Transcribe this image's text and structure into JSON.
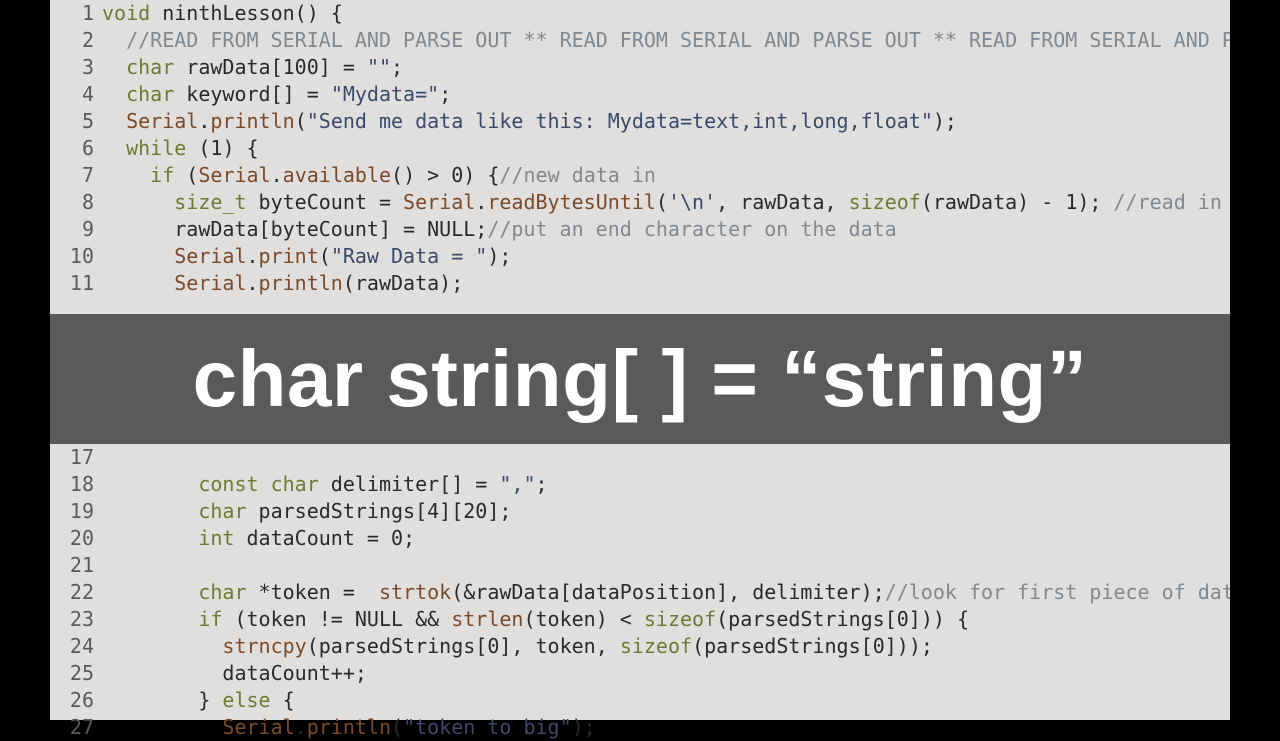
{
  "overlay_text": "char string[ ] = “string”",
  "lines": [
    {
      "n": "1",
      "html": "<span class='kw'>void</span> ninthLesson() {"
    },
    {
      "n": "2",
      "html": "  <span class='cmt'>//READ FROM SERIAL AND PARSE OUT ** READ FROM SERIAL AND PARSE OUT ** READ FROM SERIAL AND PA</span>"
    },
    {
      "n": "3",
      "html": "  <span class='kw'>char</span> rawData[<span class='num'>100</span>] = <span class='str'>\"\"</span>;"
    },
    {
      "n": "4",
      "html": "  <span class='kw'>char</span> keyword[] = <span class='str'>\"Mydata=\"</span>;"
    },
    {
      "n": "5",
      "html": "  <span class='obj'>Serial</span>.<span class='call'>println</span>(<span class='str'>\"Send me data like this: Mydata=text,int,long,float\"</span>);"
    },
    {
      "n": "6",
      "html": "  <span class='kw'>while</span> (<span class='num'>1</span>) {"
    },
    {
      "n": "7",
      "html": "    <span class='kw'>if</span> (<span class='obj'>Serial</span>.<span class='call'>available</span>() &gt; <span class='num'>0</span>) {<span class='cmt'>//new data in</span>"
    },
    {
      "n": "8",
      "html": "      <span class='type'>size_t</span> byteCount = <span class='obj'>Serial</span>.<span class='call'>readBytesUntil</span>(<span class='str'>'\\n'</span>, rawData, <span class='kw'>sizeof</span>(rawData) - <span class='num'>1</span>); <span class='cmt'>//read in </span>"
    },
    {
      "n": "9",
      "html": "      rawData[byteCount] = NULL;<span class='cmt'>//put an end character on the data</span>"
    },
    {
      "n": "10",
      "html": "      <span class='obj'>Serial</span>.<span class='call'>print</span>(<span class='str'>\"Raw Data = \"</span>);"
    },
    {
      "n": "11",
      "html": "      <span class='obj'>Serial</span>.<span class='call'>println</span>(rawData);"
    }
  ],
  "lines2": [
    {
      "n": "17",
      "html": ""
    },
    {
      "n": "18",
      "html": "        <span class='kw'>const</span> <span class='kw'>char</span> delimiter[] = <span class='str'>\",\"</span>;"
    },
    {
      "n": "19",
      "html": "        <span class='kw'>char</span> parsedStrings[<span class='num'>4</span>][<span class='num'>20</span>];"
    },
    {
      "n": "20",
      "html": "        <span class='kw'>int</span> dataCount = <span class='num'>0</span>;"
    },
    {
      "n": "21",
      "html": ""
    },
    {
      "n": "22",
      "html": "        <span class='kw'>char</span> *token =  <span class='call'>strtok</span>(&amp;rawData[dataPosition], delimiter);<span class='cmt'>//look for first piece of dat</span>"
    },
    {
      "n": "23",
      "html": "        <span class='kw'>if</span> (token != NULL &amp;&amp; <span class='call'>strlen</span>(token) &lt; <span class='kw'>sizeof</span>(parsedStrings[<span class='num'>0</span>])) {"
    },
    {
      "n": "24",
      "html": "          <span class='call'>strncpy</span>(parsedStrings[<span class='num'>0</span>], token, <span class='kw'>sizeof</span>(parsedStrings[<span class='num'>0</span>]));"
    },
    {
      "n": "25",
      "html": "          dataCount++;"
    },
    {
      "n": "26",
      "html": "        } <span class='kw'>else</span> {"
    },
    {
      "n": "27",
      "html": "          <span class='obj'>Serial</span>.<span class='call'>println</span>(<span class='str'>\"token to big\"</span>);"
    }
  ]
}
